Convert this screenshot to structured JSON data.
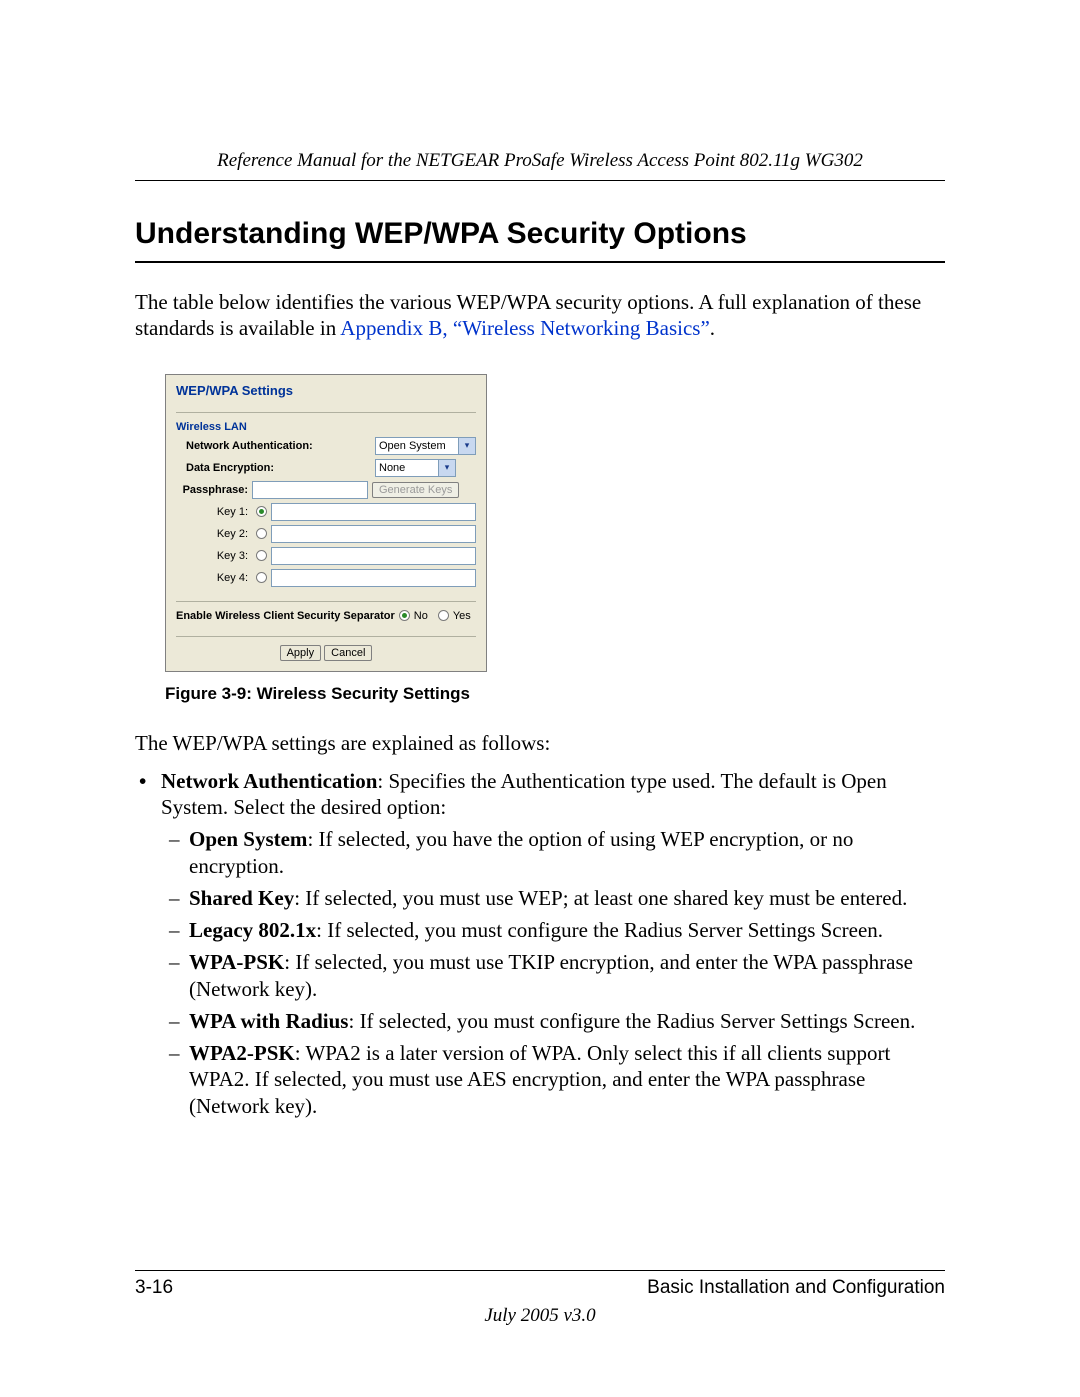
{
  "header": {
    "running": "Reference Manual for the NETGEAR ProSafe Wireless Access Point 802.11g WG302"
  },
  "title": "Understanding WEP/WPA Security Options",
  "intro_a": "The table below identifies the various WEP/WPA security options. A full explanation of these standards is available in ",
  "intro_link": "Appendix B, “Wireless Networking Basics”",
  "intro_b": ".",
  "caption": "Figure 3-9: Wireless Security Settings",
  "panel": {
    "title": "WEP/WPA Settings",
    "section": "Wireless LAN",
    "auth_label": "Network Authentication:",
    "auth_value": "Open System",
    "enc_label": "Data Encryption:",
    "enc_value": "None",
    "pass_label": "Passphrase:",
    "gen_keys": "Generate Keys",
    "key1": "Key 1:",
    "key2": "Key 2:",
    "key3": "Key 3:",
    "key4": "Key 4:",
    "sep_label": "Enable Wireless Client Security Separator",
    "no": "No",
    "yes": "Yes",
    "apply": "Apply",
    "cancel": "Cancel"
  },
  "explain_intro": "The WEP/WPA settings are explained as follows:",
  "bullet_lead_a": "Network Authentication",
  "bullet_lead_b": ": Specifies the Authentication type used. The default is Open System. Select the desired option:",
  "dashes": {
    "d1a": "Open System",
    "d1b": ": If selected, you have the option of using WEP encryption, or no encryption.",
    "d2a": "Shared Key",
    "d2b": ": If selected, you must use WEP; at least one shared key must be entered.",
    "d3a": "Legacy 802.1x",
    "d3b": ": If selected, you must configure the Radius Server Settings Screen.",
    "d4a": "WPA-PSK",
    "d4b": ": If selected, you must use TKIP encryption, and enter the WPA passphrase (Network key).",
    "d5a": "WPA with Radius",
    "d5b": ": If selected, you must configure the Radius Server Settings Screen.",
    "d6a": "WPA2-PSK",
    "d6b": ": WPA2 is a later version of WPA. Only select this if all clients support WPA2. If selected, you must use AES encryption, and enter the WPA passphrase (Network key)."
  },
  "footer": {
    "page": "3-16",
    "section": "Basic Installation and Configuration",
    "date": "July 2005 v3.0"
  }
}
